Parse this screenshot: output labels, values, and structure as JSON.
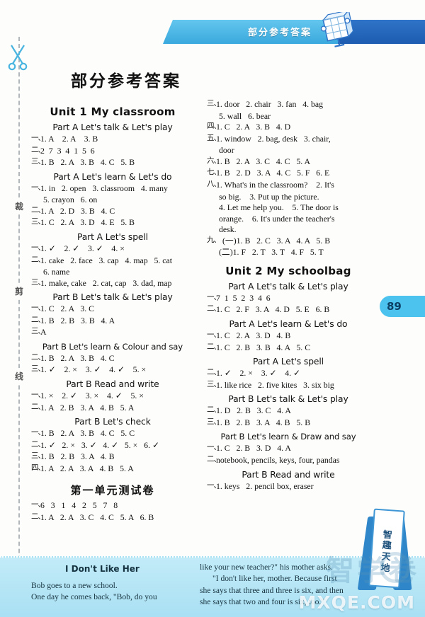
{
  "header": {
    "running_head": "部分参考答案",
    "globe_icon": "globe-book-icon"
  },
  "page": {
    "number": "89"
  },
  "margin": {
    "cut_marks": [
      "裁",
      "剪",
      "线"
    ],
    "scissors_icon": "scissors-icon"
  },
  "main_title": "部分参考答案",
  "badge": {
    "lines": [
      "智",
      "趣",
      "天",
      "地"
    ]
  },
  "watermark": {
    "cn": "智学卷",
    "url": "MXQE.COM"
  },
  "columns": {
    "left": [
      {
        "kind": "unit",
        "text": "Unit 1    My classroom"
      },
      {
        "kind": "part",
        "text": "Part A   Let's talk & Let's play"
      },
      {
        "kind": "ans",
        "num": "一、",
        "body": "1. A    2. A    3. B"
      },
      {
        "kind": "ans",
        "num": "二、",
        "body": "2  7  3  4  1  5  6"
      },
      {
        "kind": "ans",
        "num": "三、",
        "body": "1. B   2. A   3. B   4. C   5. B"
      },
      {
        "kind": "part",
        "text": "Part A   Let's learn & Let's do"
      },
      {
        "kind": "ans",
        "num": "一、",
        "body": "1. in   2. open   3. classroom   4. many"
      },
      {
        "kind": "cont",
        "text": "5. crayon   6. on"
      },
      {
        "kind": "ans",
        "num": "二、",
        "body": "1. A   2. D   3. B   4. C"
      },
      {
        "kind": "ans",
        "num": "三、",
        "body": "1. C   2. A   3. D   4. E   5. B"
      },
      {
        "kind": "part",
        "text": "Part A   Let's spell"
      },
      {
        "kind": "ans",
        "num": "一、",
        "body": "1. ✓    2. ✓    3. ✓    4. ×"
      },
      {
        "kind": "ans",
        "num": "二、",
        "body": "1. cake   2. face   3. cap   4. map   5. cat"
      },
      {
        "kind": "cont",
        "text": "6. name"
      },
      {
        "kind": "ans",
        "num": "三、",
        "body": "1. make, cake   2. cat, cap   3. dad, map"
      },
      {
        "kind": "part",
        "text": "Part B   Let's talk & Let's play"
      },
      {
        "kind": "ans",
        "num": "一、",
        "body": "1. C   2. A   3. C"
      },
      {
        "kind": "ans",
        "num": "二、",
        "body": "1. B   2. B   3. B   4. A"
      },
      {
        "kind": "ans",
        "num": "三、",
        "body": "A"
      },
      {
        "kind": "partw",
        "text": "Part B   Let's learn & Colour and say"
      },
      {
        "kind": "ans",
        "num": "二、",
        "body": "1. B   2. A   3. B   4. C"
      },
      {
        "kind": "ans",
        "num": "三、",
        "body": "1. ✓    2. ×    3. ✓    4. ✓    5. ×"
      },
      {
        "kind": "part",
        "text": "Part B   Read and write"
      },
      {
        "kind": "ans",
        "num": "一、",
        "body": "1. ×    2. ✓    3. ×    4. ✓    5. ×"
      },
      {
        "kind": "ans",
        "num": "二、",
        "body": "1. A   2. B   3. A   4. B   5. A"
      },
      {
        "kind": "part",
        "text": "Part B   Let's check"
      },
      {
        "kind": "ans",
        "num": "一、",
        "body": "1. B   2. A   3. B   4. C   5. C"
      },
      {
        "kind": "ans",
        "num": "二、",
        "body": "1. ✓   2. ×   3. ✓   4. ✓   5. ×   6. ✓"
      },
      {
        "kind": "ans",
        "num": "三、",
        "body": "1. B   2. B   3. A   4. B"
      },
      {
        "kind": "ans",
        "num": "四、",
        "body": "1. A   2. A   3. A   4. B   5. A"
      },
      {
        "kind": "test",
        "text": "第一单元测试卷"
      },
      {
        "kind": "ans",
        "num": "一、",
        "body": "6   3   1   4   2   5   7   8"
      },
      {
        "kind": "ans",
        "num": "二、",
        "body": "1. A   2. A   3. C   4. C   5. A   6. B"
      }
    ],
    "right": [
      {
        "kind": "ans",
        "num": "三、",
        "body": "1. door   2. chair   3. fan   4. bag"
      },
      {
        "kind": "cont",
        "text": "5. wall   6. bear"
      },
      {
        "kind": "ans",
        "num": "四、",
        "body": "1. C   2. A   3. B   4. D"
      },
      {
        "kind": "ans",
        "num": "五、",
        "body": "1. window   2. bag, desk   3. chair,"
      },
      {
        "kind": "cont",
        "text": "door"
      },
      {
        "kind": "ans",
        "num": "六、",
        "body": "1. B   2. A   3. C   4. C   5. A"
      },
      {
        "kind": "ans",
        "num": "七、",
        "body": "1. B   2. D   3. A   4. C   5. F   6. E"
      },
      {
        "kind": "ans",
        "num": "八、",
        "body": "1. What's in the classroom?    2. It's"
      },
      {
        "kind": "cont",
        "text": "so big.    3. Put up the picture."
      },
      {
        "kind": "cont",
        "text": "4. Let me help you.    5. The door is"
      },
      {
        "kind": "cont",
        "text": "orange.    6. It's under the teacher's"
      },
      {
        "kind": "cont",
        "text": "desk."
      },
      {
        "kind": "ans2",
        "num": "九、",
        "body": "(一)1. B   2. C   3. A   4. A   5. B"
      },
      {
        "kind": "cont",
        "text": "(二)1. F   2. T   3. T   4. F   5. T"
      },
      {
        "kind": "unit",
        "text": "Unit 2    My schoolbag"
      },
      {
        "kind": "part",
        "text": "Part A   Let's talk & Let's play"
      },
      {
        "kind": "ans",
        "num": "一、",
        "body": "7  1  5  2  3  4  6"
      },
      {
        "kind": "ans",
        "num": "二、",
        "body": "1. C   2. F   3. A   4. D   5. E   6. B"
      },
      {
        "kind": "part",
        "text": "Part A   Let's learn & Let's do"
      },
      {
        "kind": "ans",
        "num": "一、",
        "body": "1. C   2. A   3. D   4. B"
      },
      {
        "kind": "ans",
        "num": "二、",
        "body": "1. C   2. B   3. B   4. A   5. C"
      },
      {
        "kind": "part",
        "text": "Part A   Let's spell"
      },
      {
        "kind": "ans",
        "num": "二、",
        "body": "1. ✓    2. ×    3. ✓    4. ✓"
      },
      {
        "kind": "ans",
        "num": "三、",
        "body": "1. like rice   2. five kites   3. six big"
      },
      {
        "kind": "part",
        "text": "Part B   Let's talk & Let's play"
      },
      {
        "kind": "ans",
        "num": "二、",
        "body": "1. D   2. B   3. C   4. A"
      },
      {
        "kind": "ans",
        "num": "三、",
        "body": "1. B   2. B   3. A   4. B   5. B"
      },
      {
        "kind": "partw",
        "text": "Part B   Let's learn & Draw and say"
      },
      {
        "kind": "ans",
        "num": "一、",
        "body": "1. C   2. B   3. D   4. A"
      },
      {
        "kind": "ans",
        "num": "二、",
        "body": "notebook, pencils, keys, four, pandas"
      },
      {
        "kind": "part",
        "text": "Part B   Read and write"
      },
      {
        "kind": "ans",
        "num": "一、",
        "body": "1. keys   2. pencil box, eraser"
      }
    ]
  },
  "story": {
    "title": "I Don't Like Her",
    "left_lines": [
      "Bob goes to a new school.",
      "One day he comes back, \"Bob, do you"
    ],
    "right_lines": [
      "like your new teacher?\" his mother asks.",
      "\"I don't like her, mother. Because first",
      "she says that three and three is six, and then",
      "she says that two and four is six, too.\""
    ]
  }
}
